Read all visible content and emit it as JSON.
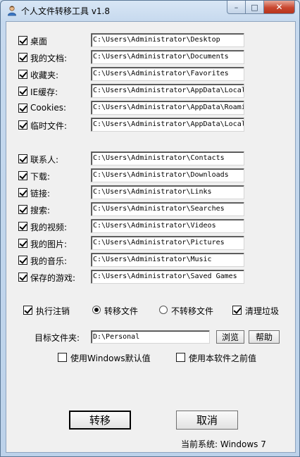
{
  "window": {
    "title": "个人文件转移工具 v1.8",
    "caption_minimize": "–",
    "caption_maximize": "□",
    "caption_close": "✕"
  },
  "group1": [
    {
      "label": "桌面",
      "checked": true,
      "path": "C:\\Users\\Administrator\\Desktop"
    },
    {
      "label": "我的文档:",
      "checked": true,
      "path": "C:\\Users\\Administrator\\Documents"
    },
    {
      "label": "收藏夹:",
      "checked": true,
      "path": "C:\\Users\\Administrator\\Favorites"
    },
    {
      "label": "IE缓存:",
      "checked": true,
      "path": "C:\\Users\\Administrator\\AppData\\Local"
    },
    {
      "label": "Cookies:",
      "checked": true,
      "path": "C:\\Users\\Administrator\\AppData\\Roami"
    },
    {
      "label": "临时文件:",
      "checked": true,
      "path": "C:\\Users\\Administrator\\AppData\\Local"
    }
  ],
  "group2": [
    {
      "label": "联系人:",
      "checked": true,
      "path": "C:\\Users\\Administrator\\Contacts"
    },
    {
      "label": "下载:",
      "checked": true,
      "path": "C:\\Users\\Administrator\\Downloads"
    },
    {
      "label": "链接:",
      "checked": true,
      "path": "C:\\Users\\Administrator\\Links"
    },
    {
      "label": "搜索:",
      "checked": true,
      "path": "C:\\Users\\Administrator\\Searches"
    },
    {
      "label": "我的视频:",
      "checked": true,
      "path": "C:\\Users\\Administrator\\Videos"
    },
    {
      "label": "我的图片:",
      "checked": true,
      "path": "C:\\Users\\Administrator\\Pictures"
    },
    {
      "label": "我的音乐:",
      "checked": true,
      "path": "C:\\Users\\Administrator\\Music"
    },
    {
      "label": "保存的游戏:",
      "checked": true,
      "path": "C:\\Users\\Administrator\\Saved Games"
    }
  ],
  "options": {
    "logoff_label": "执行注销",
    "logoff_checked": true,
    "move_label": "转移文件",
    "move_selected": true,
    "nomove_label": "不转移文件",
    "nomove_selected": false,
    "clean_label": "清理垃圾",
    "clean_checked": true
  },
  "target": {
    "label": "目标文件夹:",
    "value": "D:\\Personal",
    "browse_label": "浏览",
    "help_label": "帮助"
  },
  "defaults": {
    "windows_default_label": "使用Windows默认值",
    "windows_default_checked": false,
    "previous_label": "使用本软件之前值",
    "previous_checked": false
  },
  "actions": {
    "transfer_label": "转移",
    "cancel_label": "取消"
  },
  "status": {
    "text": "当前系统: Windows 7"
  }
}
